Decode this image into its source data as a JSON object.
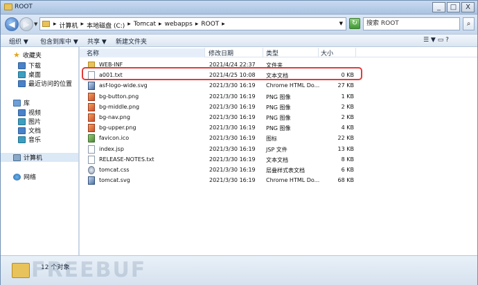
{
  "window": {
    "title": "ROOT",
    "buttons": [
      "_",
      "□",
      "X"
    ]
  },
  "address": {
    "crumbs": [
      "▸",
      "计算机",
      "▸",
      "本地磁盘 (C:)",
      "▸",
      "Tomcat",
      "▸",
      "webapps",
      "▸",
      "ROOT",
      "▸"
    ],
    "dropdown": "▼"
  },
  "search": {
    "placeholder": "搜索 ROOT",
    "icon": "magnifier-icon"
  },
  "toolbar": {
    "organize": "组织 ▼",
    "include_in_library": "包含到库中 ▼",
    "share": "共享 ▼",
    "new_folder": "新建文件夹",
    "right": "☰ ▼   ▭   ?"
  },
  "navpane": {
    "favorites": "收藏夹",
    "downloads": "下载",
    "desktop": "桌面",
    "recent": "最近访问的位置",
    "libraries": "库",
    "videos": "视频",
    "pictures": "图片",
    "documents": "文档",
    "music": "音乐",
    "computer": "计算机",
    "network": "网络"
  },
  "columns": {
    "name": "名称",
    "modified": "修改日期",
    "type": "类型",
    "size": "大小"
  },
  "files": [
    {
      "name": "WEB-INF",
      "modified": "2021/4/24 22:37",
      "type": "文件夹",
      "size": "",
      "kind": "folder"
    },
    {
      "name": "a001.txt",
      "modified": "2021/4/25 10:08",
      "type": "文本文档",
      "size": "0 KB",
      "kind": "txt"
    },
    {
      "name": "asf-logo-wide.svg",
      "modified": "2021/3/30 16:19",
      "type": "Chrome HTML Do...",
      "size": "27 KB",
      "kind": "svg"
    },
    {
      "name": "bg-button.png",
      "modified": "2021/3/30 16:19",
      "type": "PNG 图像",
      "size": "1 KB",
      "kind": "png"
    },
    {
      "name": "bg-middle.png",
      "modified": "2021/3/30 16:19",
      "type": "PNG 图像",
      "size": "2 KB",
      "kind": "png"
    },
    {
      "name": "bg-nav.png",
      "modified": "2021/3/30 16:19",
      "type": "PNG 图像",
      "size": "2 KB",
      "kind": "png"
    },
    {
      "name": "bg-upper.png",
      "modified": "2021/3/30 16:19",
      "type": "PNG 图像",
      "size": "4 KB",
      "kind": "png"
    },
    {
      "name": "favicon.ico",
      "modified": "2021/3/30 16:19",
      "type": "图标",
      "size": "22 KB",
      "kind": "ico"
    },
    {
      "name": "index.jsp",
      "modified": "2021/3/30 16:19",
      "type": "JSP 文件",
      "size": "13 KB",
      "kind": "txt"
    },
    {
      "name": "RELEASE-NOTES.txt",
      "modified": "2021/3/30 16:19",
      "type": "文本文档",
      "size": "8 KB",
      "kind": "txt"
    },
    {
      "name": "tomcat.css",
      "modified": "2021/3/30 16:19",
      "type": "层叠样式表文档",
      "size": "6 KB",
      "kind": "css"
    },
    {
      "name": "tomcat.svg",
      "modified": "2021/3/30 16:19",
      "type": "Chrome HTML Do...",
      "size": "68 KB",
      "kind": "svg"
    }
  ],
  "status": {
    "count": "12 个对象",
    "watermark": "FREEBUF"
  },
  "colors": {
    "highlight": "#e23a3a",
    "selection": "#dbe8f6"
  }
}
